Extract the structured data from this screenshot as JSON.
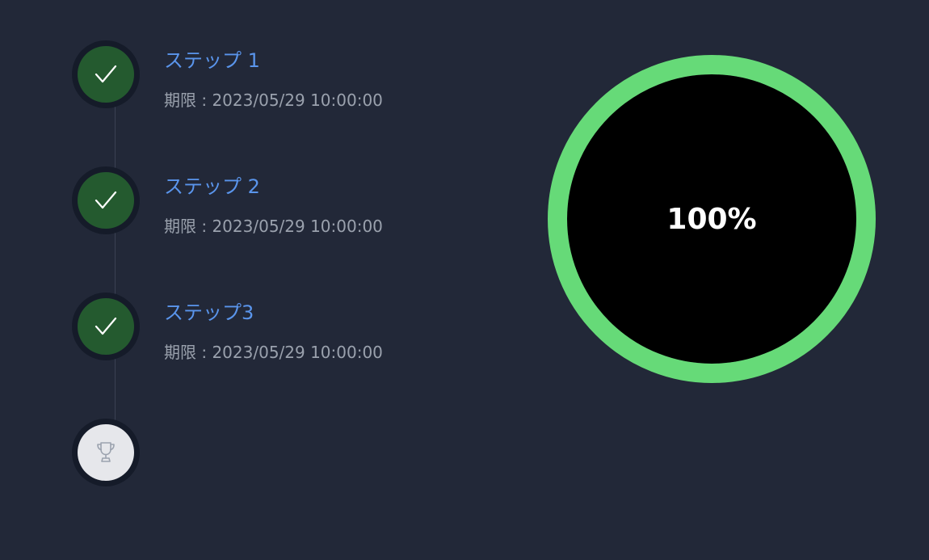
{
  "steps": [
    {
      "title": "ステップ 1",
      "deadline": "期限 : 2023/05/29 10:00:00",
      "status": "completed",
      "icon": "check-icon"
    },
    {
      "title": "ステップ 2",
      "deadline": "期限 : 2023/05/29 10:00:00",
      "status": "completed",
      "icon": "check-icon"
    },
    {
      "title": "ステップ3",
      "deadline": "期限 : 2023/05/29 10:00:00",
      "status": "completed",
      "icon": "check-icon"
    }
  ],
  "goal": {
    "icon": "trophy-icon"
  },
  "progress": {
    "percent": 100,
    "label": "100%",
    "ring_color": "#66da78",
    "fill_color": "#000000"
  },
  "colors": {
    "background": "#222838",
    "step_title": "#5a95ec",
    "completed_node": "#245a2f",
    "goal_node": "#e6e7eb"
  }
}
